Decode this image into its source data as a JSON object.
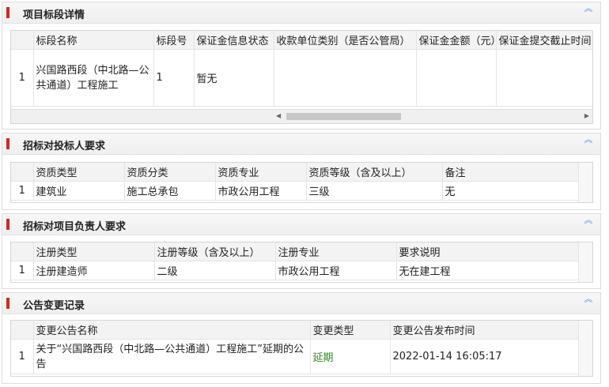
{
  "collapse_glyph": "︽",
  "sections": {
    "details": {
      "title": "项目标段详情",
      "headers": [
        "",
        "标段名称",
        "标段号",
        "保证金信息状态",
        "收款单位类别（是否公管局）",
        "保证金金额（元）",
        "保证金提交截止时间"
      ],
      "row": {
        "idx": "1",
        "name": "兴国路西段（中北路—公共通道）工程施工",
        "no": "1",
        "status": "暂无",
        "payee": "",
        "amount": "",
        "deadline": ""
      },
      "scroll_left": "◀",
      "scroll_right": "▶"
    },
    "bidder": {
      "title": "招标对投标人要求",
      "headers": [
        "",
        "资质类型",
        "资质分类",
        "资质专业",
        "资质等级（含及以上）",
        "备注"
      ],
      "row": [
        "1",
        "建筑业",
        "施工总承包",
        "市政公用工程",
        "三级",
        "无"
      ]
    },
    "manager": {
      "title": "招标对项目负责人要求",
      "headers": [
        "",
        "注册类型",
        "注册等级（含及以上）",
        "注册专业",
        "要求说明"
      ],
      "row": [
        "1",
        "注册建造师",
        "二级",
        "市政公用工程",
        "无在建工程"
      ]
    },
    "changes": {
      "title": "公告变更记录",
      "headers": [
        "",
        "变更公告名称",
        "变更类型",
        "变更公告发布时间"
      ],
      "row": {
        "idx": "1",
        "name": "关于“兴国路西段（中北路—公共通道）工程施工”延期的公告",
        "type": "延期",
        "time": "2022-01-14 16:05:17"
      }
    }
  }
}
